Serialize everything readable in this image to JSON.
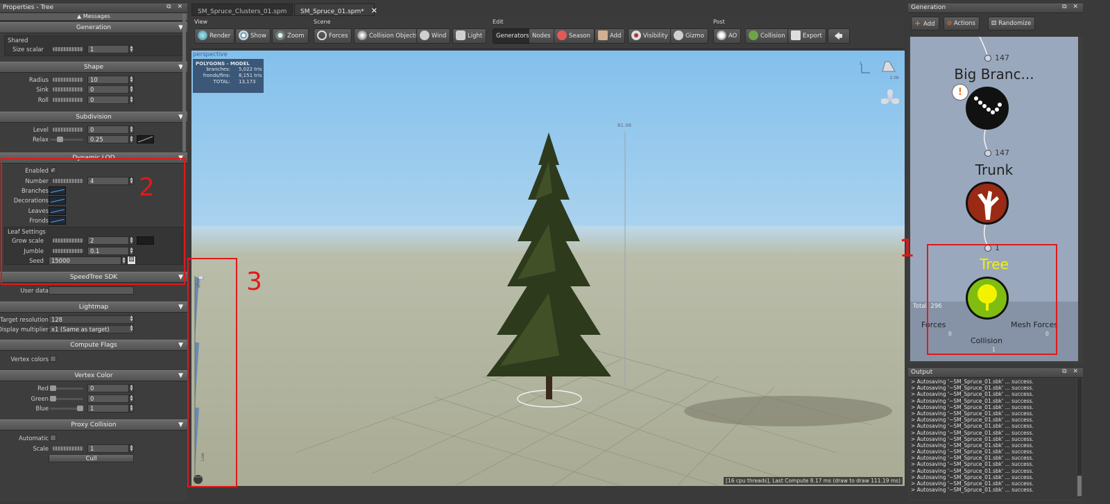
{
  "properties": {
    "title": "Properties - Tree",
    "messages": "Messages",
    "sections": {
      "generation": "Generation",
      "shape": "Shape",
      "subdivision": "Subdivision",
      "dynamic_lod": "Dynamic LOD",
      "speedtree_sdk": "SpeedTree SDK",
      "lightmap": "Lightmap",
      "compute_flags": "Compute Flags",
      "vertex_color": "Vertex Color",
      "proxy_collision": "Proxy Collision"
    },
    "shared": {
      "group": "Shared",
      "size_scalar_label": "Size scalar",
      "size_scalar": "1"
    },
    "shape": {
      "radius_label": "Radius",
      "radius": "10",
      "sink_label": "Sink",
      "sink": "0",
      "roll_label": "Roll",
      "roll": "0"
    },
    "subdivision": {
      "level_label": "Level",
      "level": "0",
      "relax_label": "Relax",
      "relax": "0.25",
      "relax_fraction": 0.25
    },
    "lod": {
      "enabled_label": "Enabled",
      "enabled_check": "✓",
      "number_label": "Number",
      "number": "4",
      "branches_label": "Branches",
      "decorations_label": "Decorations",
      "leaves_label": "Leaves",
      "fronds_label": "Fronds",
      "leaf_settings": "Leaf Settings",
      "grow_scale_label": "Grow scale",
      "grow_scale": "2",
      "jumble_label": "Jumble",
      "jumble": "0.1",
      "seed_label": "Seed",
      "seed": "15000"
    },
    "sdk": {
      "user_data_label": "User data",
      "user_data": ""
    },
    "lightmap": {
      "target_res_label": "Target resolution",
      "target_res": "128",
      "display_mult_label": "Display multiplier",
      "display_mult": "x1 (Same as target)"
    },
    "compute": {
      "vertex_colors_label": "Vertex colors"
    },
    "vertex_color": {
      "red_label": "Red",
      "red": "0",
      "green_label": "Green",
      "green": "0",
      "blue_label": "Blue",
      "blue": "1"
    },
    "proxy": {
      "automatic_label": "Automatic",
      "scale_label": "Scale",
      "scale": "1",
      "cull_label": "Cull"
    }
  },
  "tabs": [
    {
      "label": "SM_Spruce_Clusters_01.spm",
      "close": "✕"
    },
    {
      "label": "SM_Spruce_01.spm*",
      "close": "✕"
    }
  ],
  "toolbar": {
    "groups": {
      "view": "View",
      "scene": "Scene",
      "edit": "Edit",
      "post": "Post"
    },
    "buttons": {
      "render": "Render",
      "show": "Show",
      "zoom": "Zoom",
      "forces": "Forces",
      "collision_objects": "Collision Objects",
      "wind": "Wind",
      "light": "Light",
      "generators": "Generators",
      "nodes": "Nodes",
      "season": "Season",
      "add": "Add",
      "visibility": "Visibility",
      "gizmo": "Gizmo",
      "ao": "AO",
      "collision": "Collision",
      "export": "Export",
      "back": "🡄"
    }
  },
  "viewport": {
    "label": "perspective",
    "poly_title": "POLYGONS - MODEL",
    "stats": [
      {
        "k": "branches:",
        "v": "5,022",
        "u": "tris"
      },
      {
        "k": "fronds/fins:",
        "v": "8,151",
        "u": "tris"
      },
      {
        "k": "TOTAL:",
        "v": "13,173",
        "u": ""
      }
    ],
    "height_readout": "81.06",
    "light_readout": "2.0b",
    "lod_high": "High",
    "lod_low": "Low",
    "status": "[16 cpu threads], Last Compute 8.17 ms (draw to draw 111.19 ms)",
    "dots": "⋯"
  },
  "annotations": {
    "one": "1",
    "two": "2",
    "three": "3"
  },
  "generation_panel": {
    "title": "Generation",
    "add": "Add",
    "actions": "Actions",
    "randomize": "Randomize",
    "nodes": [
      {
        "title": "Big Branc...",
        "count": "147"
      },
      {
        "title": "Trunk",
        "count": "147"
      },
      {
        "title": "Tree",
        "count": "1"
      }
    ],
    "total": "Total: 296",
    "forces": "Forces",
    "forces_count": "0",
    "mesh_forces": "Mesh Forces",
    "mesh_forces_count": "0",
    "collision": "Collision",
    "collision_count": "1"
  },
  "output": {
    "title": "Output",
    "lines": [
      "> Autosaving '~SM_Spruce_01.sbk' ... success.",
      "> Autosaving '~SM_Spruce_01.sbk' ... success.",
      "> Autosaving '~SM_Spruce_01.sbk' ... success.",
      "> Autosaving '~SM_Spruce_01.sbk' ... success.",
      "> Autosaving '~SM_Spruce_01.sbk' ... success.",
      "> Autosaving '~SM_Spruce_01.sbk' ... success.",
      "> Autosaving '~SM_Spruce_01.sbk' ... success.",
      "> Autosaving '~SM_Spruce_01.sbk' ... success.",
      "> Autosaving '~SM_Spruce_01.sbk' ... success.",
      "> Autosaving '~SM_Spruce_01.sbk' ... success.",
      "> Autosaving '~SM_Spruce_01.sbk' ... success.",
      "> Autosaving '~SM_Spruce_01.sbk' ... success.",
      "> Autosaving '~SM_Spruce_01.sbk' ... success.",
      "> Autosaving '~SM_Spruce_01.sbk' ... success.",
      "> Autosaving '~SM_Spruce_01.sbk' ... success.",
      "> Autosaving '~SM_Spruce_01.sbk' ... success.",
      "> Autosaving '~SM_Spruce_01.sbk' ... success.",
      "> Autosaving '~SM_Spruce_01.sbk' ... success."
    ]
  },
  "panel_controls": "⧉ ✕",
  "colors": {
    "accent_red": "#e0191a",
    "tree_node": "#7fbd10",
    "trunk_node": "#9a2a14",
    "viewport_sky": "#8ec6ee",
    "viewport_ground": "#aeae96"
  },
  "icons": [
    "globe-icon",
    "eye-icon",
    "zoom-icon",
    "magnet-icon",
    "sphere-icon",
    "wind-icon",
    "light-icon",
    "season-icon",
    "plus-icon",
    "visibility-icon",
    "gizmo-icon",
    "ao-icon",
    "leaf-icon",
    "export-icon",
    "back-arrow-icon",
    "dice-icon",
    "spotlight-icon",
    "fan-icon"
  ]
}
